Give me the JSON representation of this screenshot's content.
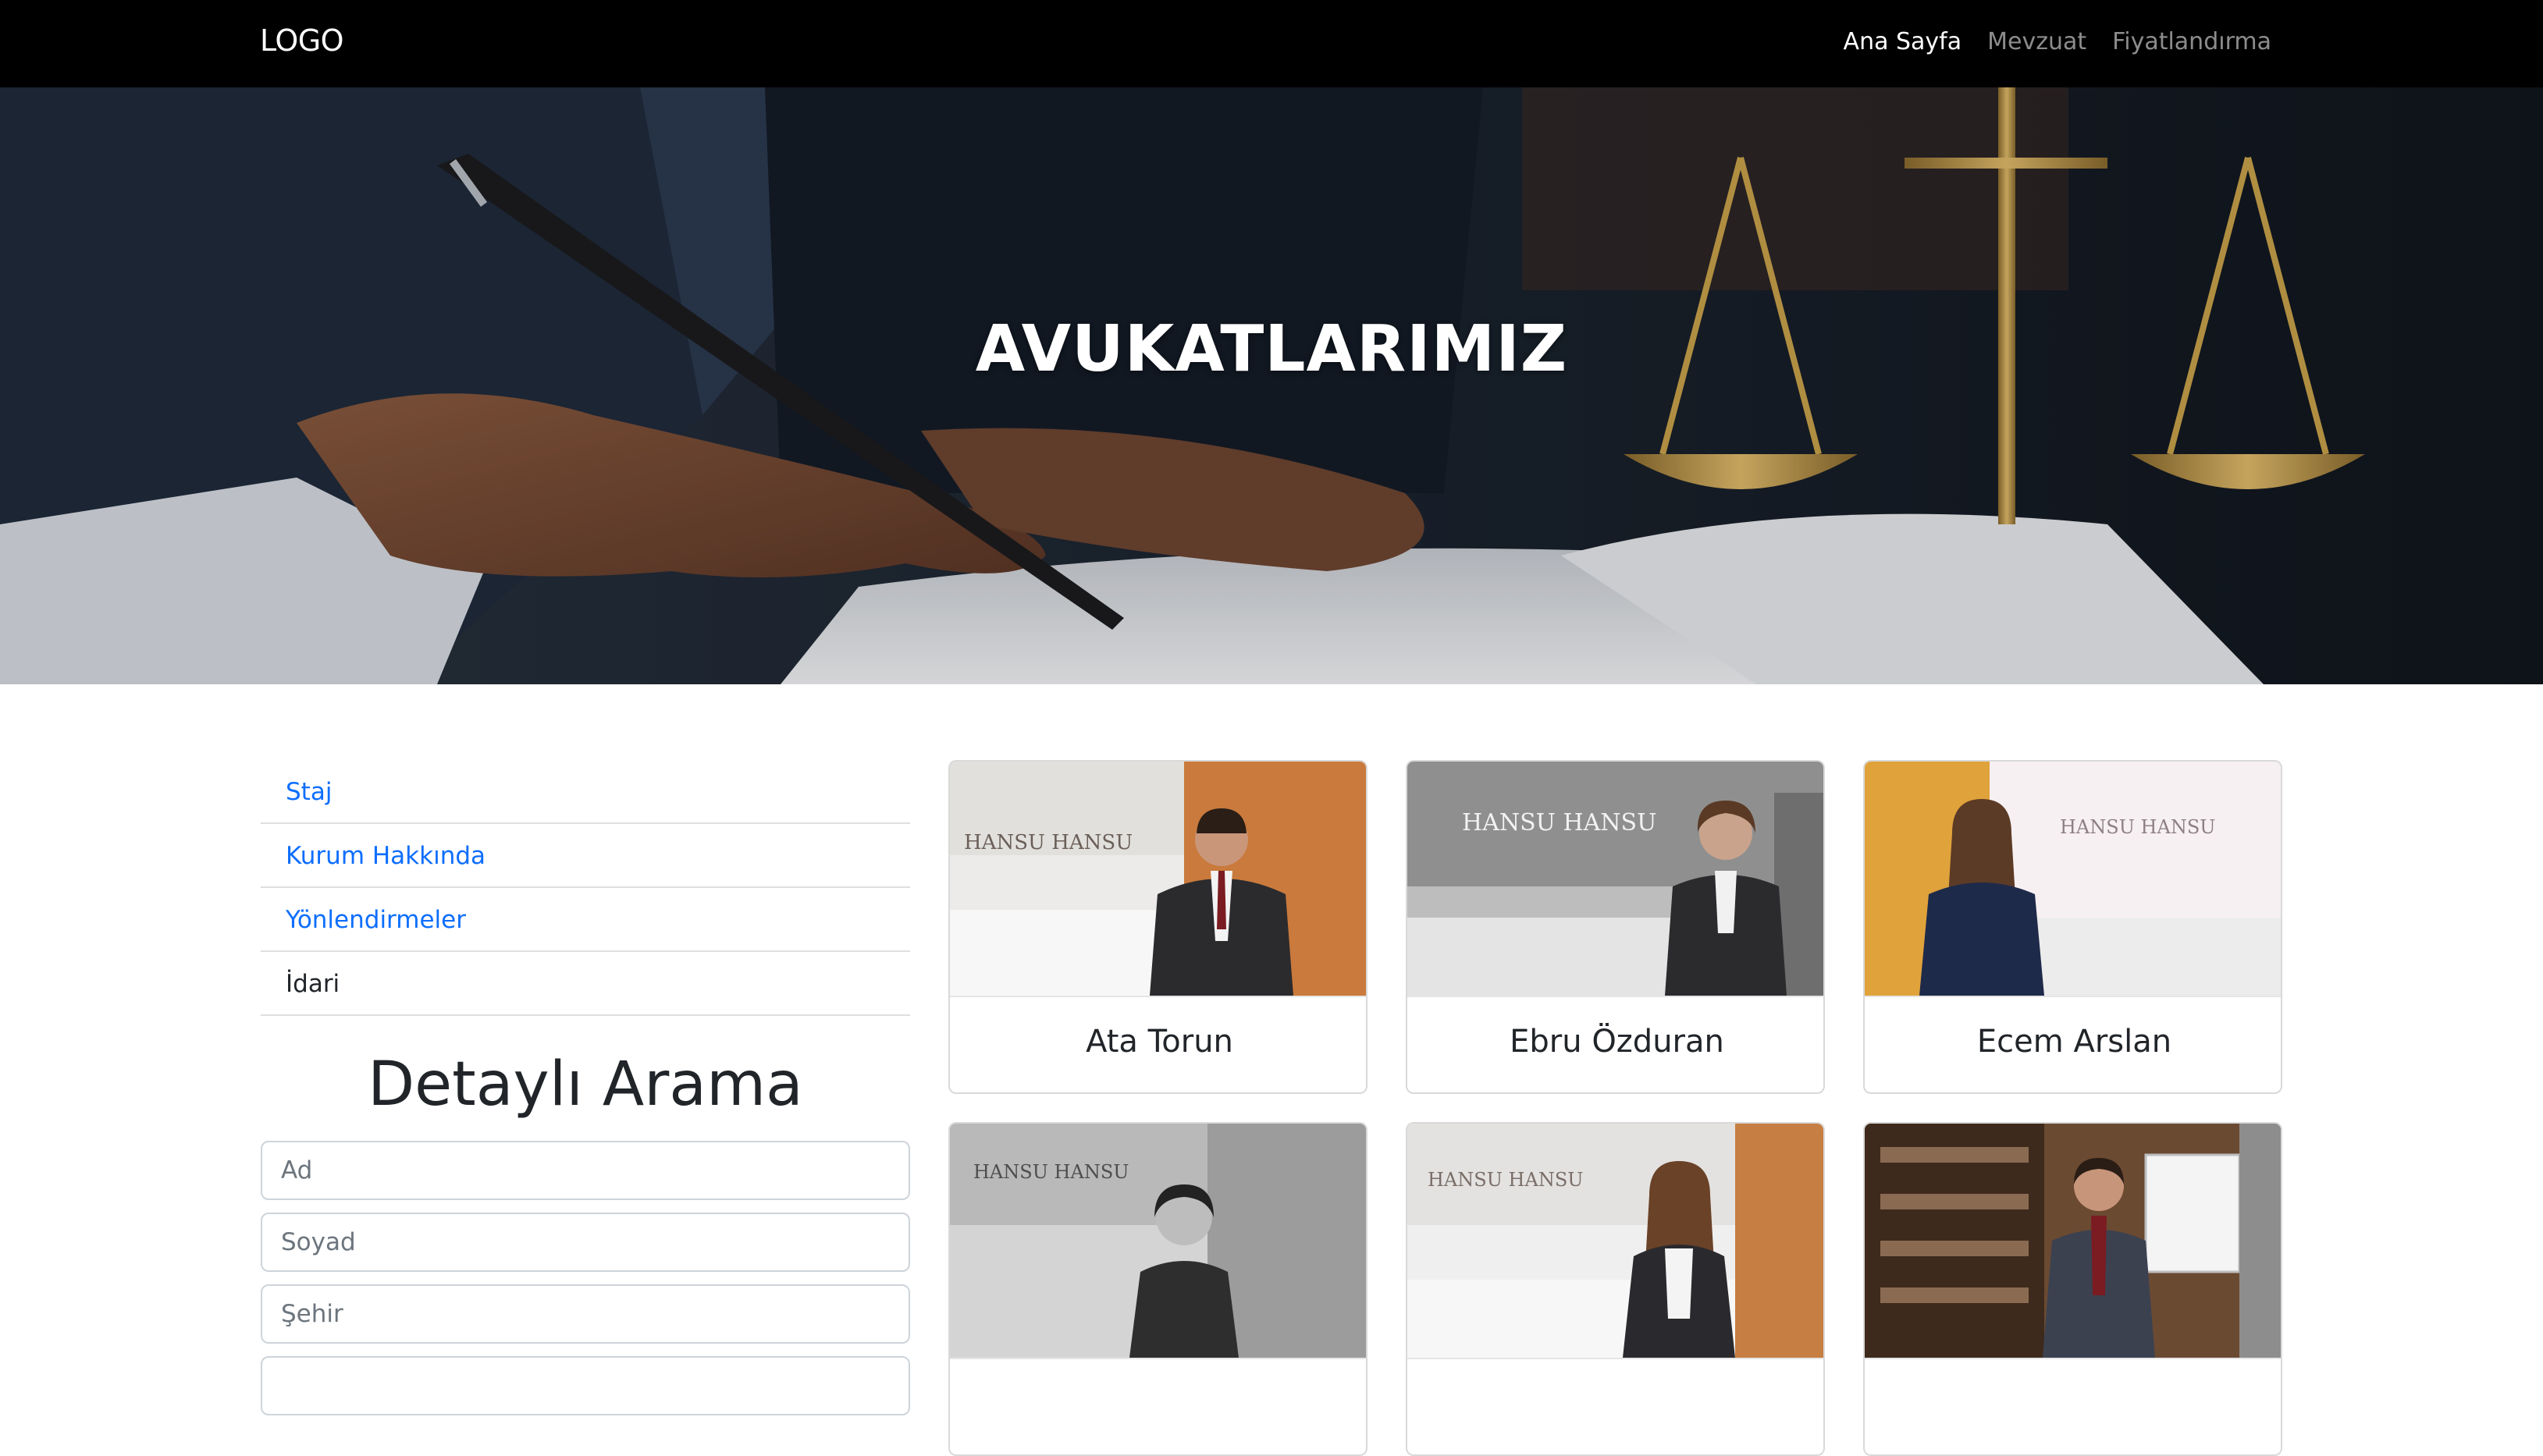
{
  "navbar": {
    "brand": "LOGO",
    "links": [
      {
        "label": "Ana Sayfa",
        "active": true
      },
      {
        "label": "Mevzuat",
        "active": false
      },
      {
        "label": "Fiyatlandırma",
        "active": false
      }
    ]
  },
  "hero": {
    "title": "AVUKATLARIMIZ"
  },
  "sidebar": {
    "items": [
      {
        "label": "Staj"
      },
      {
        "label": "Kurum Hakkında"
      },
      {
        "label": "Yönlendirmeler"
      },
      {
        "label": "İdari"
      }
    ]
  },
  "search": {
    "title": "Detaylı Arama",
    "fields": [
      {
        "placeholder": "Ad"
      },
      {
        "placeholder": "Soyad"
      },
      {
        "placeholder": "Şehir"
      }
    ]
  },
  "lawyers": [
    {
      "name": "Ata Torun",
      "sign": "HANSU HANSU"
    },
    {
      "name": "Ebru Özduran",
      "sign": "HANSU HANSU"
    },
    {
      "name": "Ecem Arslan",
      "sign": "HANSU HANSU"
    },
    {
      "name": "",
      "sign": "HANSU HANSU"
    },
    {
      "name": "",
      "sign": "HANSU HANSU"
    },
    {
      "name": "",
      "sign": ""
    }
  ],
  "colors": {
    "navbar_bg": "#000000",
    "link_blue": "#0d6efd",
    "hero_bg": "#1a222d",
    "gold": "#c9a24a"
  }
}
